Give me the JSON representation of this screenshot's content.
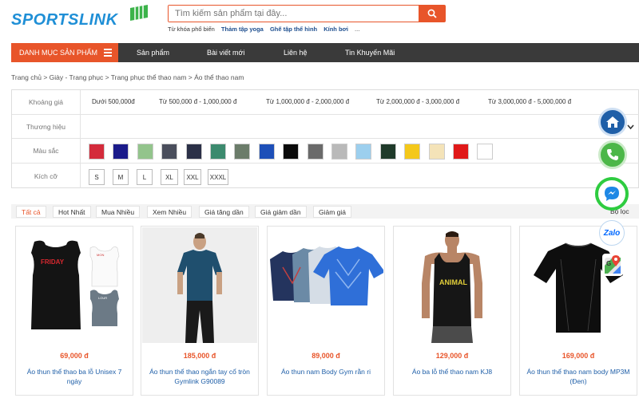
{
  "header": {
    "logo_text": "SPORTSLINK",
    "search_placeholder": "Tìm kiếm sản phẩm tại đây...",
    "keywords_label": "Từ khóa phổ biến",
    "keywords": [
      "Thảm tập yoga",
      "Ghế tập thể hình",
      "Kính bơi",
      "..."
    ]
  },
  "nav": {
    "category_label": "DANH MỤC SẢN PHẨM",
    "items": [
      "Sản phẩm",
      "Bài viết mới",
      "Liên hệ",
      "Tin Khuyến Mãi"
    ]
  },
  "breadcrumb": "Trang chủ > Giày - Trang phục > Trang phục thể thao nam > Áo thể thao nam",
  "filters": {
    "price_label": "Khoảng giá",
    "prices": [
      "Dưới 500,000đ",
      "Từ 500,000 đ - 1,000,000 đ",
      "Từ 1,000,000 đ - 2,000,000 đ",
      "Từ 2,000,000 đ - 3,000,000 đ",
      "Từ 3,000,000 đ - 5,000,000 đ"
    ],
    "brand_label": "Thương hiệu",
    "color_label": "Màu sắc",
    "colors": [
      "#d42b3b",
      "#1b1b8a",
      "#93c48c",
      "#4a4e5c",
      "#2b3047",
      "#3c8a6e",
      "#6b7c6a",
      "#1d4fb8",
      "#0a0a0a",
      "#6a6a6a",
      "#b9b9b9",
      "#9ccfee",
      "#1f3a2a",
      "#f4c81a",
      "#f4e3b8",
      "#e01919",
      "#ffffff"
    ],
    "size_label": "Kích cỡ",
    "sizes": [
      "S",
      "M",
      "L",
      "XL",
      "XXL",
      "XXXL"
    ]
  },
  "sort": {
    "options": [
      "Tất cả",
      "Hot Nhất",
      "Mua Nhiều",
      "Xem Nhiều",
      "Giá tăng dần",
      "Giá giảm dần",
      "Giảm giá"
    ],
    "filter_label": "Bộ lọc"
  },
  "products": [
    {
      "price": "69,000 đ",
      "name": "Áo thun thể thao ba lỗ Unisex 7 ngày"
    },
    {
      "price": "185,000 đ",
      "name": "Áo thun thể thao ngắn tay cổ tròn Gymlink G90089"
    },
    {
      "price": "89,000 đ",
      "name": "Áo thun nam Body Gym rằn ri"
    },
    {
      "price": "129,000 đ",
      "name": "Áo ba lỗ thể thao nam KJ8"
    },
    {
      "price": "169,000 đ",
      "name": "Áo thun thể thao nam body MP3M (Đen)"
    }
  ],
  "floating": {
    "zalo_label": "Zalo"
  },
  "colors": {
    "accent": "#e8552a",
    "nav_bg": "#3a3a3a",
    "link": "#1f5fa8"
  }
}
